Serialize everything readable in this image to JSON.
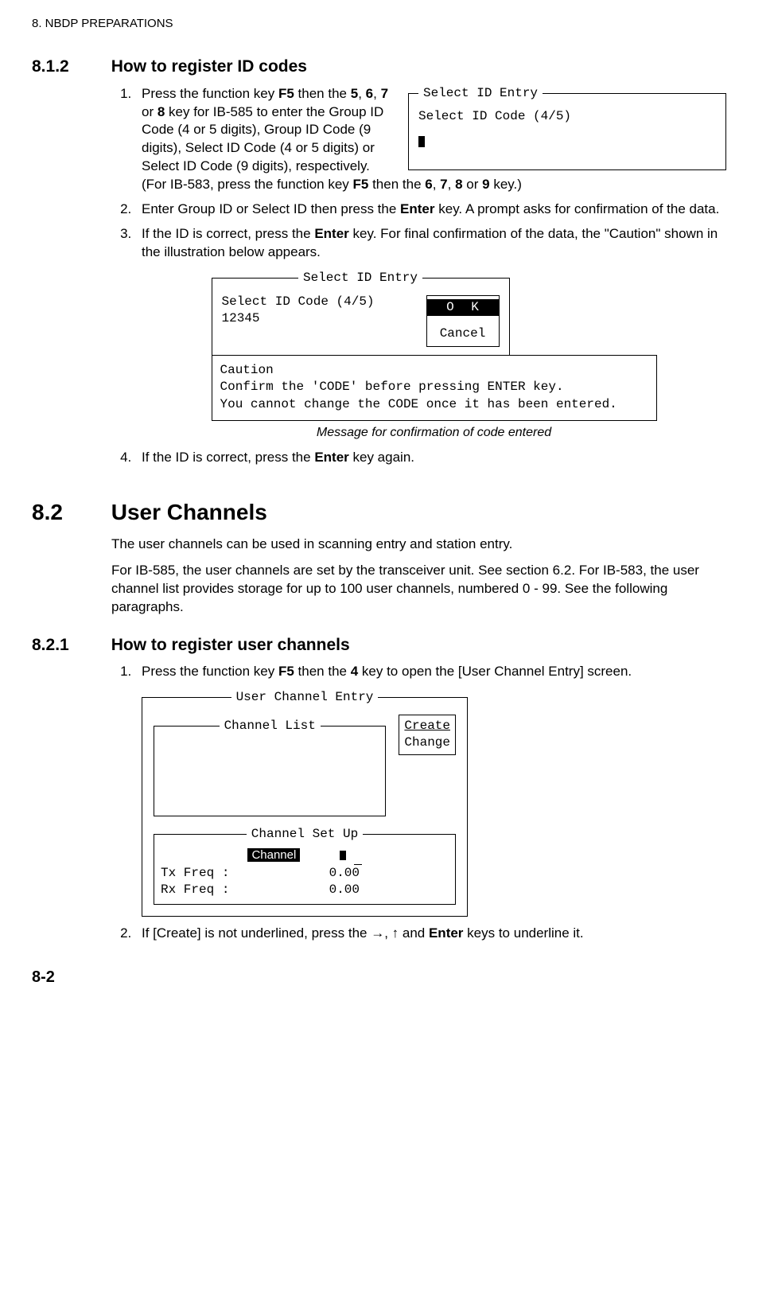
{
  "header": "8.  NBDP PREPARATIONS",
  "sec812": {
    "num": "8.1.2",
    "title": "How to register ID codes",
    "step1_a": "Press the function key ",
    "step1_b": " then the ",
    "step1_c": ", ",
    "step1_d": " or ",
    "step1_e": " key for IB-585 to enter the Group ID Code (4 or 5 digits), Group ID Code (9 digits), Select ID Code (4 or 5 digits) or Select ID Code (9 digits), respectively. (For IB-583, press the function key ",
    "step1_f": " then the ",
    "step1_g": ", ",
    "step1_h": " or ",
    "step1_i": " key.)",
    "k_f5": "F5",
    "k_5": "5",
    "k_6": "6",
    "k_7": "7",
    "k_8": "8",
    "k_9": "9",
    "step2_a": "Enter Group ID or Select ID then press the ",
    "step2_b": " key. A prompt asks for confirmation of the data.",
    "enter": "Enter",
    "step3_a": "If the ID is correct, press the ",
    "step3_b": " key. For final confirmation of the data, the \"Caution\" shown in the illustration below appears.",
    "step4_a": "If the ID is correct, press the ",
    "step4_b": " key again."
  },
  "fig1": {
    "legend": "Select ID Entry",
    "line1": "Select ID Code (4/5)"
  },
  "fig2": {
    "legend": "Select ID Entry",
    "line1": "Select ID Code (4/5)",
    "line2": "12345",
    "ok": "O   K",
    "cancel": "Cancel",
    "caution_title": "Caution",
    "caution_l1": "Confirm the 'CODE' before pressing ENTER key.",
    "caution_l2": "You cannot change the CODE once it has been entered.",
    "caption": "Message for confirmation of code entered"
  },
  "sec82": {
    "num": "8.2",
    "title": "User Channels",
    "p1": "The user channels can be used in scanning entry and station entry.",
    "p2": "For IB-585, the user channels are set by the transceiver unit. See section 6.2. For IB-583, the user channel list provides storage for up to 100 user channels, numbered 0 - 99. See the following paragraphs."
  },
  "sec821": {
    "num": "8.2.1",
    "title": "How to register user channels",
    "step1_a": "Press the function key ",
    "step1_b": " then the ",
    "step1_c": " key to open the [User Channel Entry] screen.",
    "k_4": "4",
    "step2_a": "If [Create] is not underlined, press the →, ↑ and ",
    "step2_b": " keys to underline it."
  },
  "fig3": {
    "outer": "User Channel Entry",
    "list": "Channel List",
    "create": "Create",
    "change": "Change",
    "setup": "Channel Set Up",
    "channel": "Channel",
    "tx": "Tx Freq  :",
    "rx": "Rx Freq  :",
    "zero": "0.00"
  },
  "pagenum": "8-2"
}
